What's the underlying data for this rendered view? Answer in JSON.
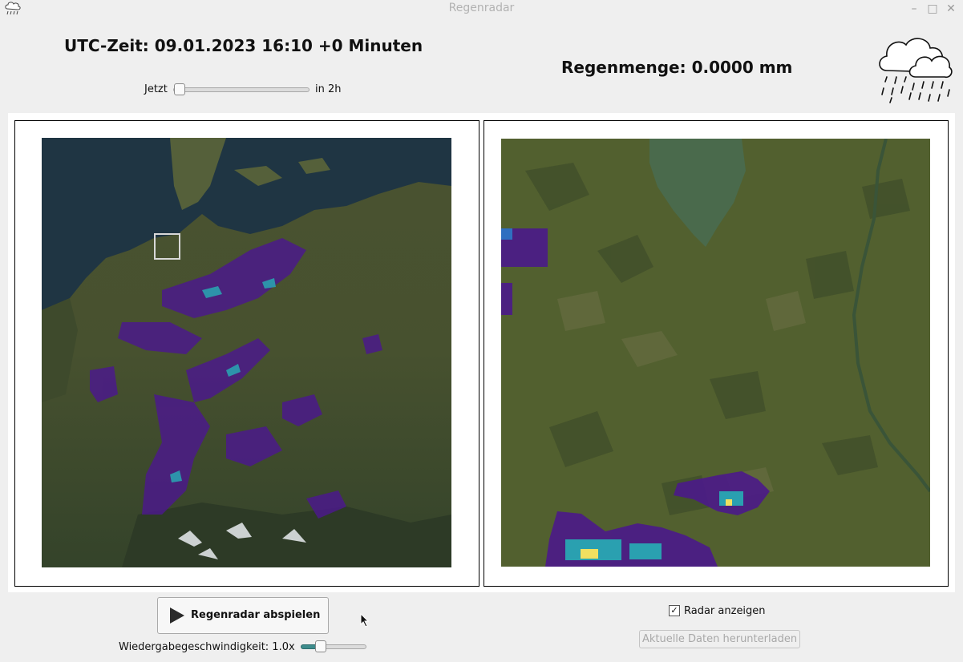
{
  "window": {
    "title": "Regenradar"
  },
  "header": {
    "utc_time": "UTC-Zeit: 09.01.2023 16:10 +0 Minuten",
    "rain_amount": "Regenmenge: 0.0000 mm",
    "weather_icon": "rain-cloud-icon"
  },
  "time_slider": {
    "left_label": "Jetzt",
    "right_label": "in 2h",
    "value_fraction": 0.0
  },
  "maps": {
    "overview": {
      "name": "radar-overview-map"
    },
    "detail": {
      "name": "radar-detail-map"
    }
  },
  "controls": {
    "play_button": "Regenradar abspielen",
    "play_icon": "play-icon",
    "speed_label": "Wiedergabegeschwindigkeit: 1.0x",
    "speed_fraction": 0.25,
    "show_radar_label": "Radar anzeigen",
    "show_radar_checked": true,
    "download_button": "Aktuelle Daten herunterladen"
  },
  "colors": {
    "accent": "#3d8c8c",
    "radar_low": "#4b1a8a",
    "radar_mid": "#2aa0b0",
    "radar_high": "#f0e060"
  }
}
